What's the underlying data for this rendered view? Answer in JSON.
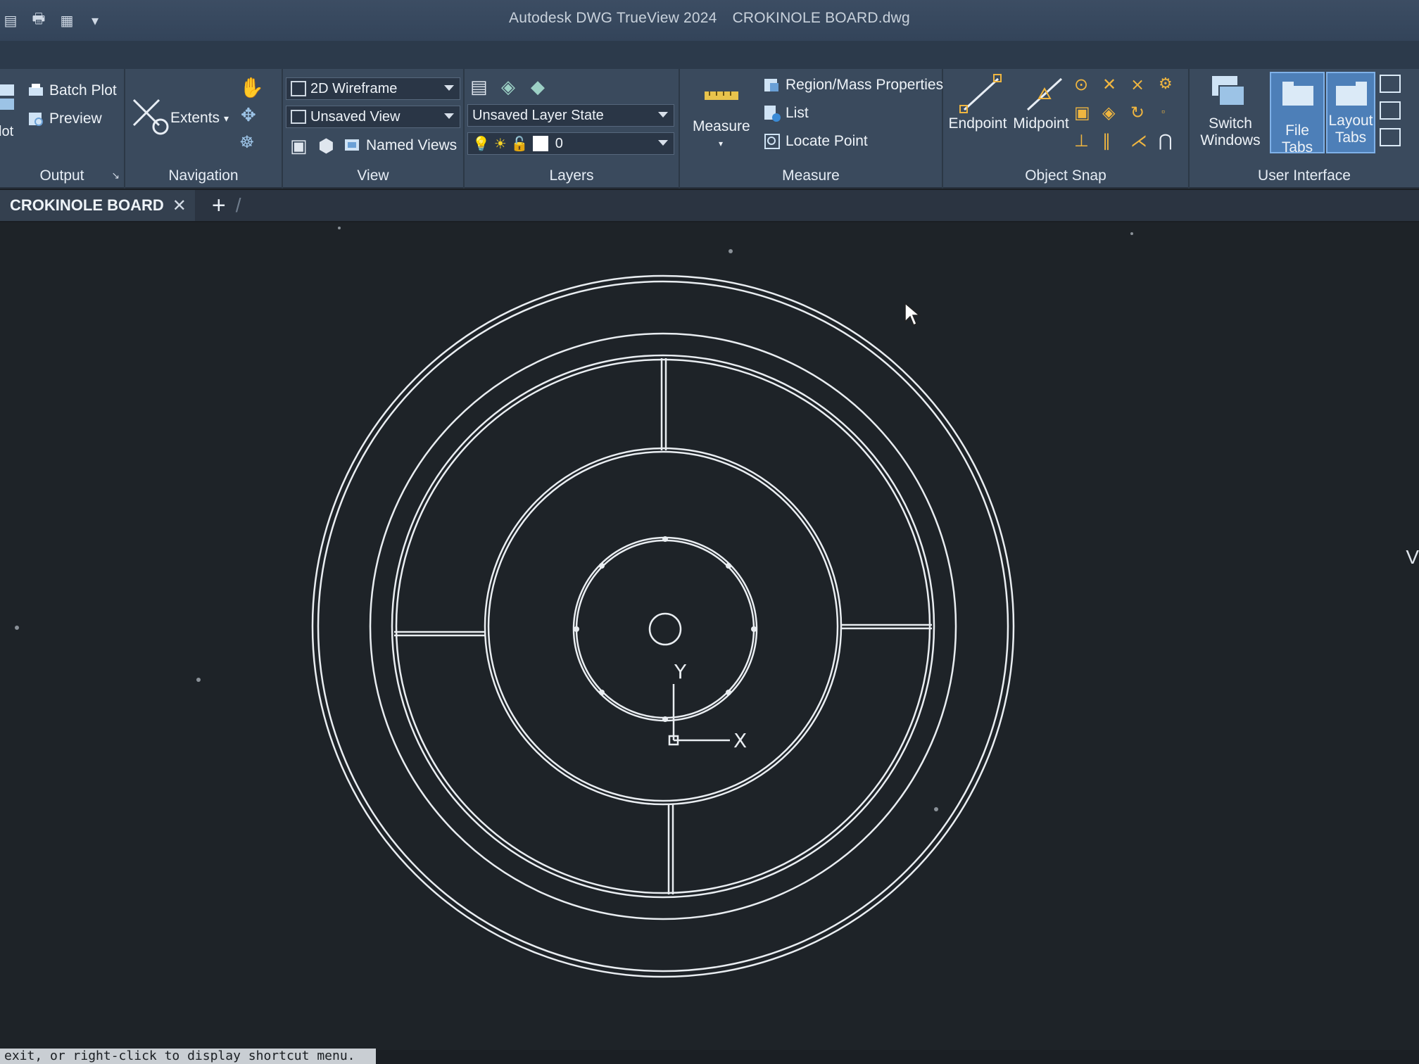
{
  "window": {
    "app_title": "Autodesk DWG TrueView 2024",
    "document_title": "CROKINOLE BOARD.dwg"
  },
  "ribbon": {
    "output": {
      "title": "Output",
      "plot_label": "lot",
      "batch_plot": "Batch Plot",
      "preview": "Preview"
    },
    "navigation": {
      "title": "Navigation",
      "extents": "Extents"
    },
    "view": {
      "title": "View",
      "visual_style": "2D Wireframe",
      "saved_view": "Unsaved View",
      "named_views": "Named Views"
    },
    "layers": {
      "title": "Layers",
      "layer_state": "Unsaved Layer State",
      "current_layer": "0"
    },
    "measure": {
      "title": "Measure",
      "measure_button": "Measure",
      "region_mass": "Region/Mass Properties",
      "list": "List",
      "locate_point": "Locate Point"
    },
    "object_snap": {
      "title": "Object Snap",
      "endpoint": "Endpoint",
      "midpoint": "Midpoint"
    },
    "user_interface": {
      "title": "User Interface",
      "switch_windows_line1": "Switch",
      "switch_windows_line2": "Windows",
      "file_tabs": "File Tabs",
      "layout_tabs_line1": "Layout",
      "layout_tabs_line2": "Tabs"
    }
  },
  "tabs": {
    "active_file": "CROKINOLE BOARD"
  },
  "ucs": {
    "x_label": "X",
    "y_label": "Y"
  },
  "command_line": {
    "text": "exit, or right-click to display shortcut menu."
  },
  "edge_text": "V",
  "colors": {
    "ribbon_bg": "#3a4a5d",
    "canvas_bg": "#1e2328",
    "line_color": "#e9edf1",
    "active_toggle": "#4d7fb8"
  }
}
